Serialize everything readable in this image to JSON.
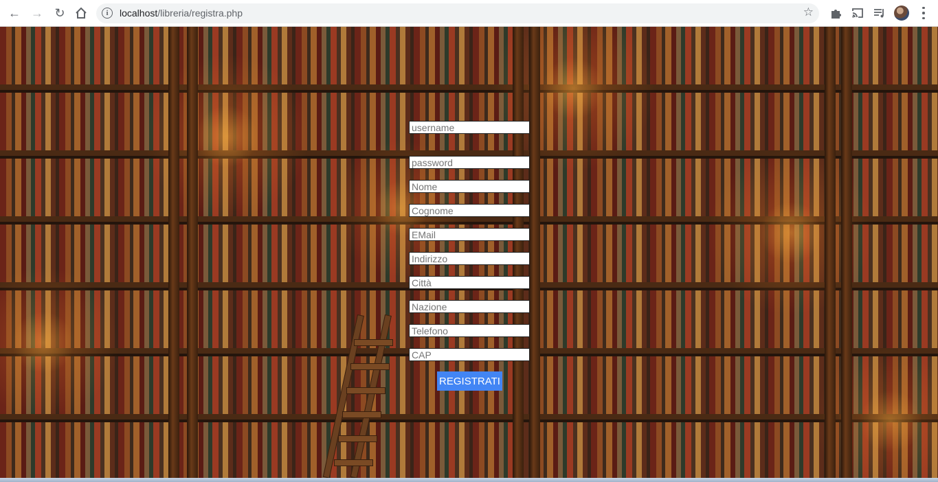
{
  "browser": {
    "url_host": "localhost",
    "url_path": "/libreria/registra.php"
  },
  "form": {
    "fields": [
      {
        "name": "username",
        "placeholder": "username"
      },
      {
        "name": "password",
        "placeholder": "password"
      },
      {
        "name": "nome",
        "placeholder": "Nome"
      },
      {
        "name": "cognome",
        "placeholder": "Cognome"
      },
      {
        "name": "email",
        "placeholder": "EMail"
      },
      {
        "name": "indirizzo",
        "placeholder": "Indirizzo"
      },
      {
        "name": "citta",
        "placeholder": "Città"
      },
      {
        "name": "nazione",
        "placeholder": "Nazione"
      },
      {
        "name": "telefono",
        "placeholder": "Telefono"
      },
      {
        "name": "cap",
        "placeholder": "CAP"
      }
    ],
    "submit_label": "REGISTRATI"
  },
  "icons": {
    "back": "arrow-left-icon",
    "forward": "arrow-right-icon",
    "reload": "reload-icon",
    "home": "home-icon",
    "info": "info-icon",
    "bookmark": "star-icon",
    "extensions": "puzzle-icon",
    "cast": "cast-icon",
    "media": "media-queue-icon",
    "menu": "three-dots-icon"
  },
  "colors": {
    "submit_button": "#4285f4",
    "page_background": "#21150e"
  }
}
